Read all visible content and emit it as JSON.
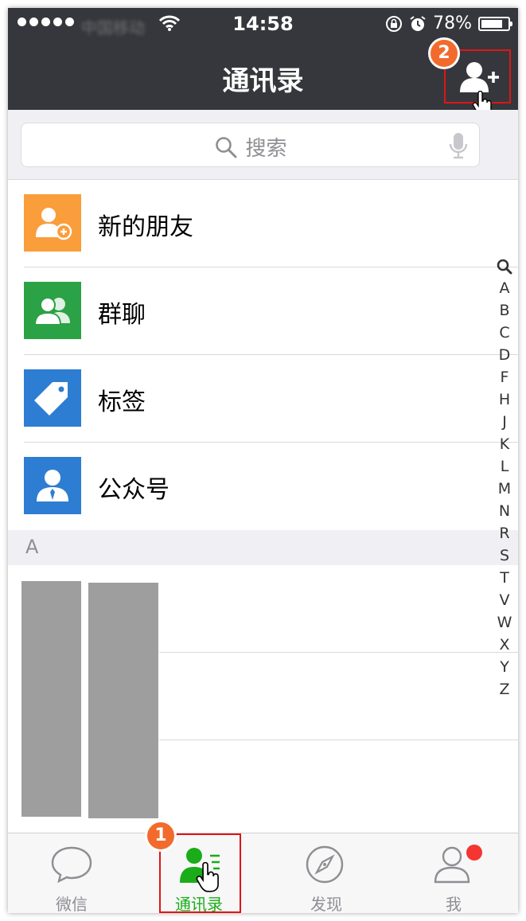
{
  "status_bar": {
    "carrier": "中国移动",
    "time": "14:58",
    "battery": "78%",
    "battery_level": 0.78
  },
  "header": {
    "title": "通讯录",
    "add_friend_icon": "add-user-icon",
    "step_badge": "2"
  },
  "search": {
    "placeholder": "搜索",
    "icon": "search-icon",
    "voice_icon": "microphone-icon"
  },
  "list": [
    {
      "label": "新的朋友",
      "icon": "new-friend-icon",
      "color": "#fa9d3b"
    },
    {
      "label": "群聊",
      "icon": "group-chat-icon",
      "color": "#2ba245"
    },
    {
      "label": "标签",
      "icon": "tag-icon",
      "color": "#2d7dd2"
    },
    {
      "label": "公众号",
      "icon": "official-account-icon",
      "color": "#2d7dd2"
    }
  ],
  "section": {
    "letter": "A"
  },
  "index_bar": [
    "A",
    "B",
    "C",
    "D",
    "F",
    "H",
    "J",
    "K",
    "L",
    "M",
    "N",
    "R",
    "S",
    "T",
    "V",
    "W",
    "X",
    "Y",
    "Z"
  ],
  "tabbar": {
    "tabs": [
      {
        "label": "微信",
        "icon": "chat-bubble-icon",
        "active": false
      },
      {
        "label": "通讯录",
        "icon": "contacts-icon",
        "active": true
      },
      {
        "label": "发现",
        "icon": "compass-icon",
        "active": false
      },
      {
        "label": "我",
        "icon": "person-icon",
        "active": false
      }
    ],
    "step_badge": "1"
  },
  "colors": {
    "header_bg": "#36373c",
    "accent_green": "#1aad19",
    "highlight_red": "#e01515",
    "badge_orange": "#f26b2c",
    "notification_red": "#f43530"
  }
}
